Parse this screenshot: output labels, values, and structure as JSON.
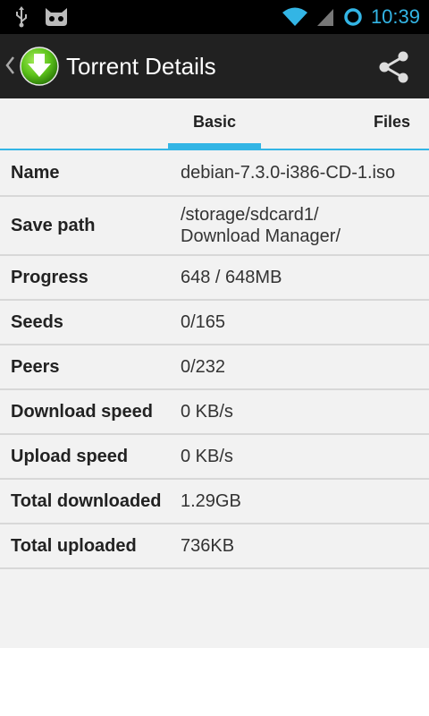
{
  "status_bar": {
    "time": "10:39",
    "icons": [
      "usb-icon",
      "cyanogen-mascot-icon",
      "wifi-icon",
      "signal-icon",
      "sync-icon"
    ]
  },
  "action_bar": {
    "title": "Torrent Details",
    "icons": [
      "back-chevron-icon",
      "download-logo-icon",
      "share-icon"
    ]
  },
  "tabs": [
    {
      "label": "Basic",
      "selected": true
    },
    {
      "label": "Files",
      "selected": false
    }
  ],
  "details": [
    {
      "label": "Name",
      "value": "debian-7.3.0-i386-CD-1.iso"
    },
    {
      "label": "Save path",
      "value": "/storage/sdcard1/\nDownload Manager/"
    },
    {
      "label": "Progress",
      "value": "648 / 648MB"
    },
    {
      "label": "Seeds",
      "value": "0/165"
    },
    {
      "label": "Peers",
      "value": "0/232"
    },
    {
      "label": "Download speed",
      "value": "0 KB/s"
    },
    {
      "label": "Upload speed",
      "value": "0 KB/s"
    },
    {
      "label": "Total downloaded",
      "value": "1.29GB"
    },
    {
      "label": "Total uploaded",
      "value": "736KB"
    }
  ],
  "colors": {
    "accent": "#33b5e5",
    "action_bar": "#212121",
    "logo_green": "#5cc21a"
  }
}
